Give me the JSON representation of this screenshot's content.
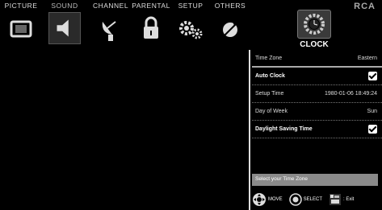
{
  "tabs": [
    {
      "label": "PICTURE",
      "icon": "tv-icon"
    },
    {
      "label": "SOUND",
      "icon": "speaker-icon"
    },
    {
      "label": "CHANNEL",
      "icon": "satellite-dish-icon"
    },
    {
      "label": "PARENTAL",
      "icon": "lock-icon"
    },
    {
      "label": "SETUP",
      "icon": "gears-icon"
    },
    {
      "label": "OTHERS",
      "icon": "satellite-icon"
    }
  ],
  "brand": "RCA",
  "section": {
    "title": "CLOCK",
    "icon": "clock-gear-icon"
  },
  "settings": [
    {
      "label": "Time Zone",
      "value": "Eastern"
    },
    {
      "label": "Auto Clock",
      "value": ""
    },
    {
      "label": "Setup Time",
      "value": "1980-01-06 18:49:24"
    },
    {
      "label": "Day of Week",
      "value": "Sun"
    },
    {
      "label": "Daylight Saving Time",
      "value": ""
    }
  ],
  "help_text": "Select your Time Zone",
  "footer": {
    "move": "MOVE",
    "select": "SELECT",
    "exit": ": Exit"
  }
}
